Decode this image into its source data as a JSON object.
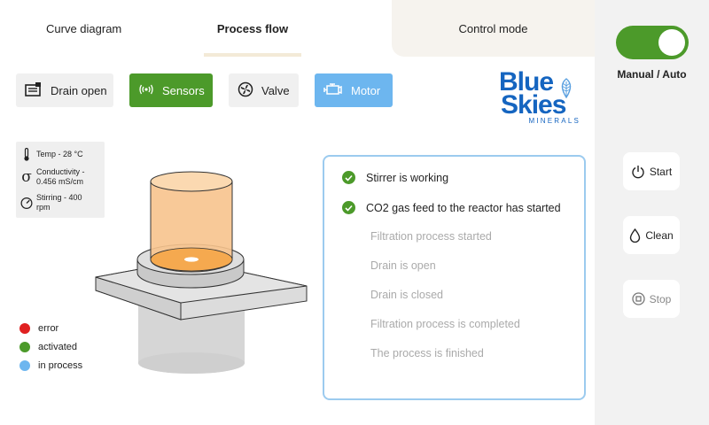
{
  "tabs": {
    "curve": "Curve diagram",
    "process": "Process flow",
    "control": "Control mode"
  },
  "actions": [
    {
      "label": "Drain open",
      "state": "idle",
      "icon": "drain-icon"
    },
    {
      "label": "Sensors",
      "state": "activated",
      "icon": "sensor-waves-icon"
    },
    {
      "label": "Valve",
      "state": "idle",
      "icon": "valve-fan-icon"
    },
    {
      "label": "Motor",
      "state": "in process",
      "icon": "motor-icon"
    }
  ],
  "logo": {
    "line1": "Blue",
    "line2": "Skies",
    "line3": "MINERALS"
  },
  "sensors": {
    "temp": "Temp - 28 °C",
    "conductivity_1": "Conductivity -",
    "conductivity_2": "0.456 mS/cm",
    "stirring_1": "Stirring - 400",
    "stirring_2": "rpm"
  },
  "legend": {
    "error": "error",
    "activated": "activated",
    "in_process": "in process"
  },
  "status": {
    "done": [
      "Stirrer is working",
      "CO2 gas feed to the reactor has started"
    ],
    "pending": [
      "Filtration process started",
      "Drain is open",
      "Drain is closed",
      "Filtration process is completed",
      "The process is finished"
    ]
  },
  "mode": {
    "label": "Manual / Auto",
    "toggle_on": true
  },
  "controls": {
    "start": "Start",
    "clean": "Clean",
    "stop": "Stop"
  },
  "colors": {
    "green": "#4c9a2a",
    "blue": "#6db6ef",
    "red": "#e02020",
    "accent_orange": "#f7b56a"
  }
}
